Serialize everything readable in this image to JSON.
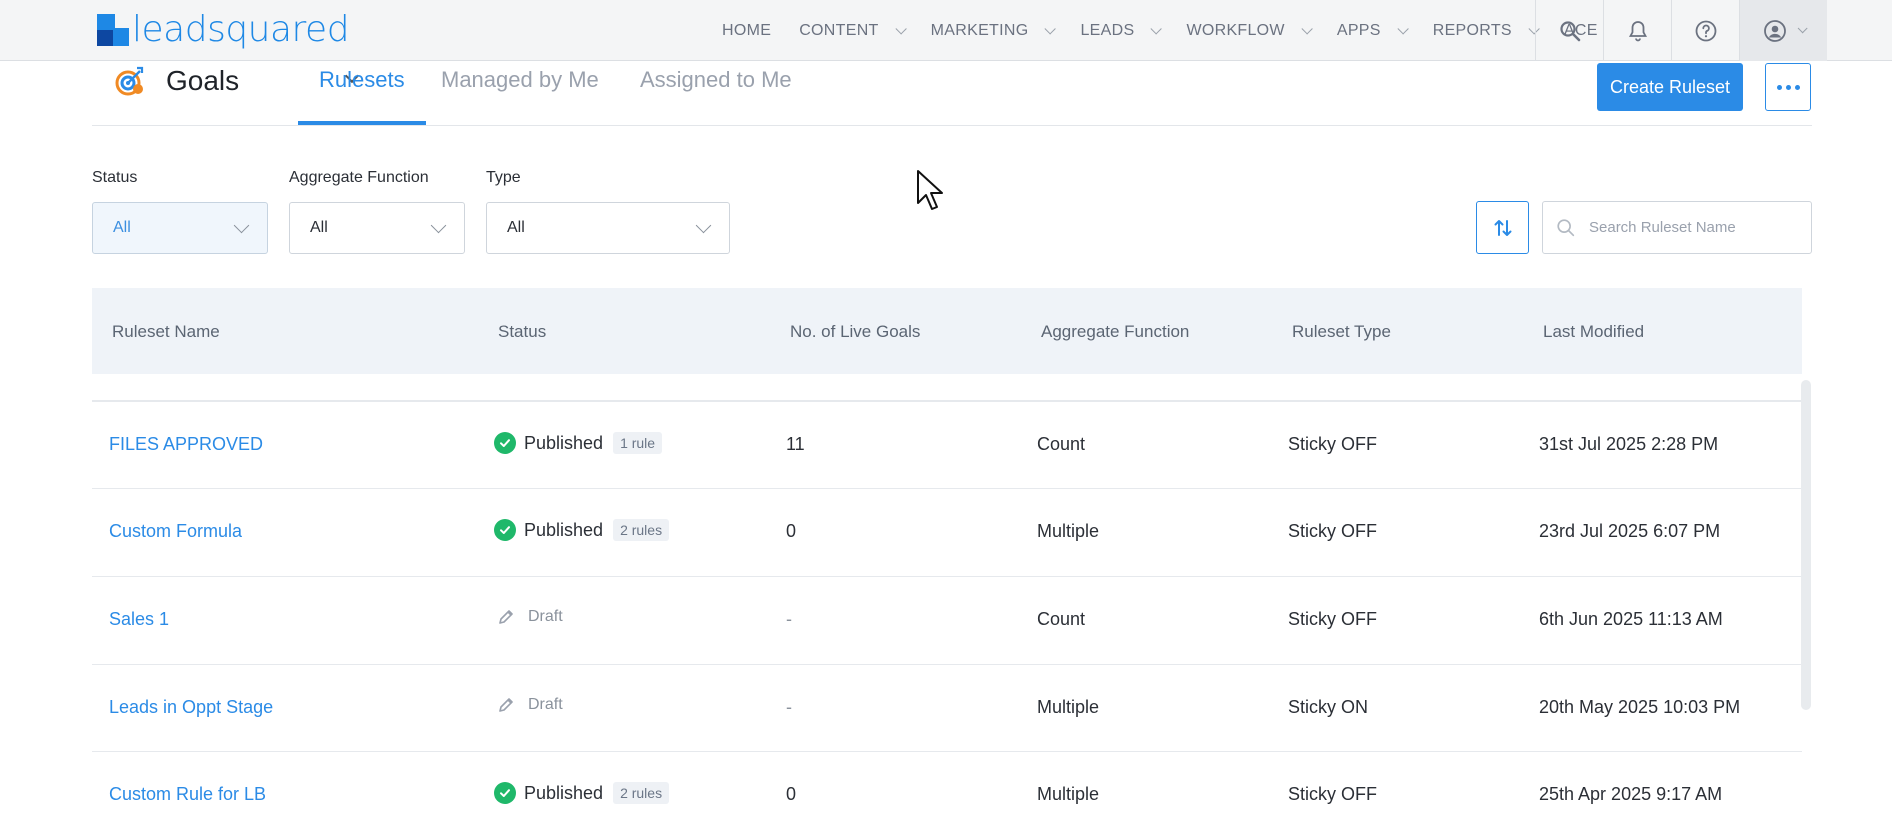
{
  "brand": {
    "logo_text": "leadsquared"
  },
  "nav": {
    "items": [
      {
        "label": "HOME",
        "dropdown": false
      },
      {
        "label": "CONTENT",
        "dropdown": true
      },
      {
        "label": "MARKETING",
        "dropdown": true
      },
      {
        "label": "LEADS",
        "dropdown": true
      },
      {
        "label": "WORKFLOW",
        "dropdown": true
      },
      {
        "label": "APPS",
        "dropdown": true
      },
      {
        "label": "REPORTS",
        "dropdown": true
      },
      {
        "label": "ACE",
        "dropdown": false
      }
    ],
    "icons": [
      "search-icon",
      "bell-icon",
      "help-icon",
      "user-profile-icon"
    ]
  },
  "header": {
    "title": "Goals",
    "tabs": [
      {
        "label": "Rulesets",
        "active": true
      },
      {
        "label": "Managed by Me",
        "active": false
      },
      {
        "label": "Assigned to Me",
        "active": false
      }
    ],
    "create_label": "Create Ruleset"
  },
  "filters": {
    "status": {
      "label": "Status",
      "value": "All"
    },
    "aggregate": {
      "label": "Aggregate Function",
      "value": "All"
    },
    "type": {
      "label": "Type",
      "value": "All"
    },
    "search_placeholder": "Search Ruleset Name"
  },
  "table": {
    "columns": [
      "Ruleset Name",
      "Status",
      "No. of Live Goals",
      "Aggregate Function",
      "Ruleset Type",
      "Last Modified"
    ],
    "rows": [
      {
        "name": "FILES APPROVED",
        "status": "Published",
        "rules": "1 rule",
        "live_goals": "11",
        "aggregate": "Count",
        "type": "Sticky OFF",
        "modified": "31st Jul 2025 2:28 PM"
      },
      {
        "name": "Custom Formula",
        "status": "Published",
        "rules": "2 rules",
        "live_goals": "0",
        "aggregate": "Multiple",
        "type": "Sticky OFF",
        "modified": "23rd Jul 2025 6:07 PM"
      },
      {
        "name": "Sales 1",
        "status": "Draft",
        "rules": "",
        "live_goals": "-",
        "aggregate": "Count",
        "type": "Sticky OFF",
        "modified": "6th Jun 2025 11:13 AM"
      },
      {
        "name": "Leads in Oppt Stage",
        "status": "Draft",
        "rules": "",
        "live_goals": "-",
        "aggregate": "Multiple",
        "type": "Sticky ON",
        "modified": "20th May 2025 10:03 PM"
      },
      {
        "name": "Custom Rule for LB",
        "status": "Published",
        "rules": "2 rules",
        "live_goals": "0",
        "aggregate": "Multiple",
        "type": "Sticky OFF",
        "modified": "25th Apr 2025 9:17 AM"
      }
    ]
  },
  "colors": {
    "accent": "#2b8be6",
    "published": "#1fb86a",
    "header_bg": "#eff3f8"
  }
}
